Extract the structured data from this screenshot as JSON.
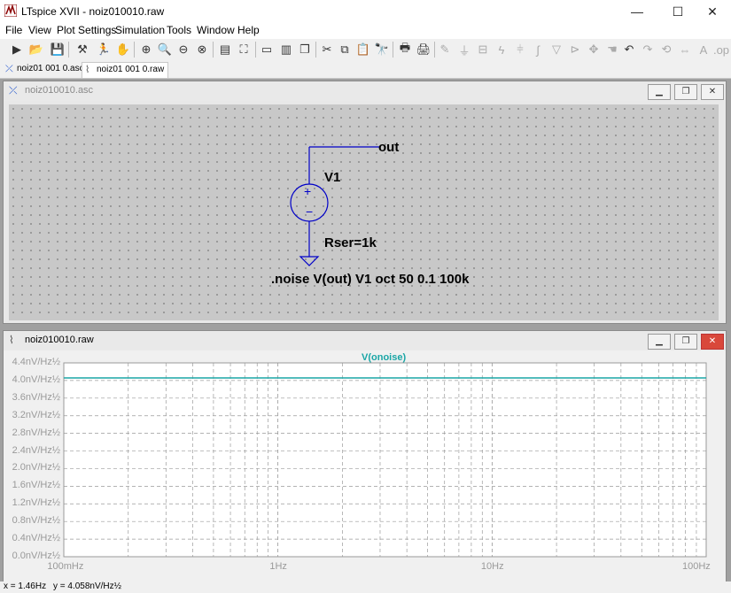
{
  "app": {
    "title": "LTspice XVII - noiz010010.raw"
  },
  "window_controls": {
    "minimize": "—",
    "maximize": "☐",
    "close": "✕"
  },
  "menu": [
    "File",
    "View",
    "Plot Settings",
    "Simulation",
    "Tools",
    "Window",
    "Help"
  ],
  "tabs": [
    {
      "label": "noiz01 001 0.asc",
      "active": false
    },
    {
      "label": "noiz01 001 0.raw",
      "active": true
    }
  ],
  "schematic_window": {
    "title": "noiz010010.asc",
    "labels": {
      "net_label": "out",
      "source_name": "V1",
      "source_param": "Rser=1k",
      "directive": ".noise V(out) V1 oct 50 0.1 100k"
    }
  },
  "plot_window": {
    "title": "noiz010010.raw",
    "trace_label": "V(onoise)"
  },
  "chart_data": {
    "type": "line",
    "title": "V(onoise)",
    "xscale": "log",
    "xlim": [
      0.1,
      100
    ],
    "x_ticks": [
      "100mHz",
      "1Hz",
      "10Hz",
      "100Hz"
    ],
    "ylim": [
      0,
      4.4
    ],
    "y_ticks": [
      "4.4nV/Hz½",
      "4.0nV/Hz½",
      "3.6nV/Hz½",
      "3.2nV/Hz½",
      "2.8nV/Hz½",
      "2.4nV/Hz½",
      "2.0nV/Hz½",
      "1.6nV/Hz½",
      "1.2nV/Hz½",
      "0.8nV/Hz½",
      "0.4nV/Hz½",
      "0.0nV/Hz½"
    ],
    "y_tick_values": [
      4.4,
      4.0,
      3.6,
      3.2,
      2.8,
      2.4,
      2.0,
      1.6,
      1.2,
      0.8,
      0.4,
      0.0
    ],
    "grid": true,
    "series": [
      {
        "name": "V(onoise)",
        "color": "#1aa6a6",
        "x": [
          0.1,
          1,
          10,
          100
        ],
        "y": [
          4.058,
          4.058,
          4.058,
          4.058
        ]
      }
    ]
  },
  "status": {
    "x": "x = 1.46Hz",
    "y": "y = 4.058nV/Hz½"
  },
  "colors": {
    "wire": "#0000c8",
    "trace": "#1aa6a6",
    "grid": "#9a9a9a"
  }
}
